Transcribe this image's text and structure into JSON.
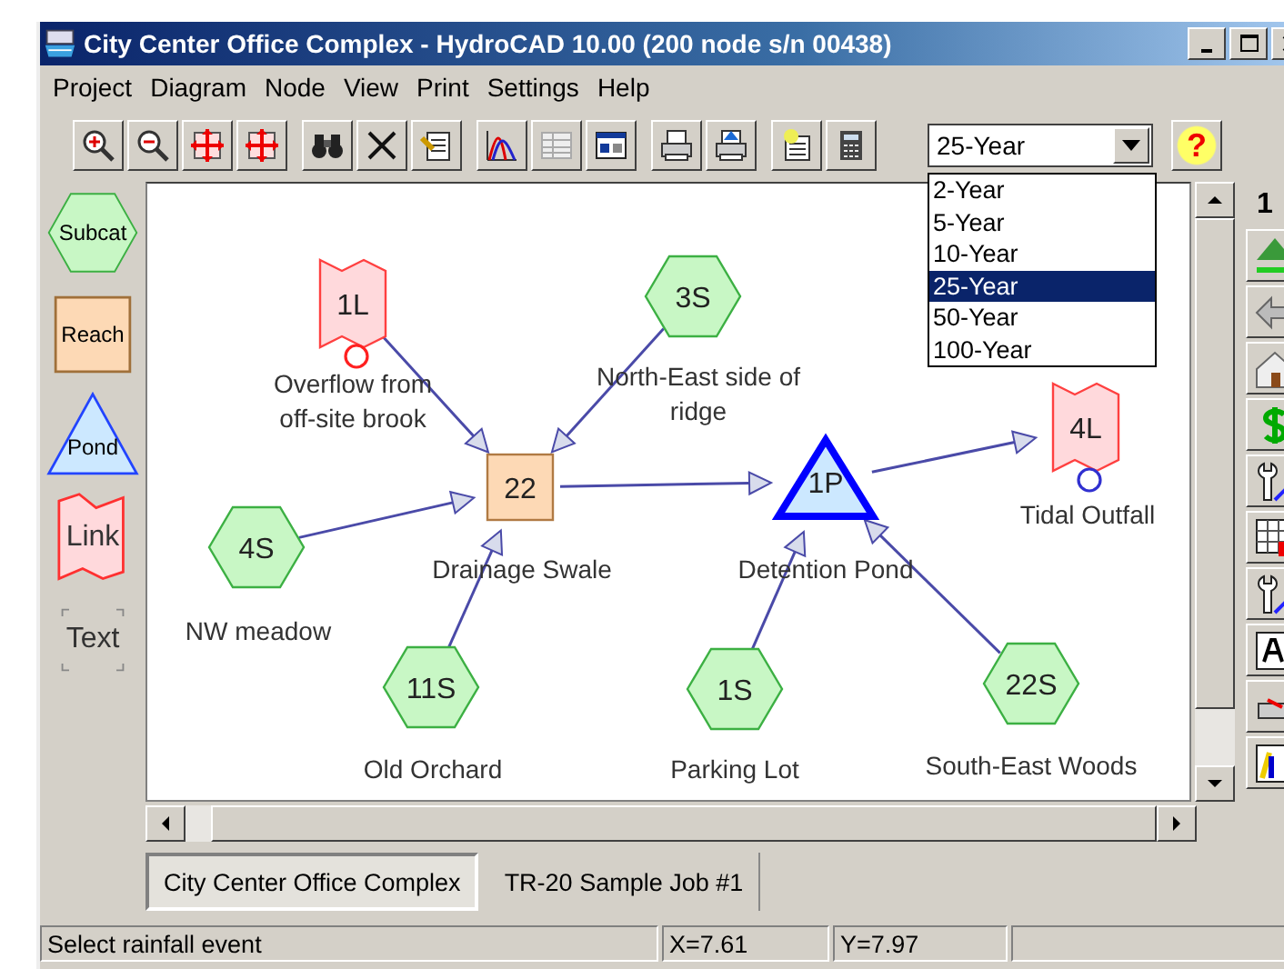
{
  "window": {
    "title": "City Center Office Complex - HydroCAD 10.00 (200 node s/n 00438)"
  },
  "menu": [
    "Project",
    "Diagram",
    "Node",
    "View",
    "Print",
    "Settings",
    "Help"
  ],
  "rainfall": {
    "value": "25-Year",
    "options": [
      {
        "label": "2-Year",
        "selected": false
      },
      {
        "label": "5-Year",
        "selected": false
      },
      {
        "label": "10-Year",
        "selected": false
      },
      {
        "label": "25-Year",
        "selected": true
      },
      {
        "label": "50-Year",
        "selected": false
      },
      {
        "label": "100-Year",
        "selected": false
      }
    ]
  },
  "help_button": {
    "label": "?"
  },
  "palette": [
    {
      "kind": "subcat",
      "label": "Subcat"
    },
    {
      "kind": "reach",
      "label": "Reach"
    },
    {
      "kind": "pond",
      "label": "Pond"
    },
    {
      "kind": "link",
      "label": "Link"
    },
    {
      "kind": "text",
      "label": "Text"
    }
  ],
  "nodes": [
    {
      "kind": "link",
      "id": "1L",
      "label": [
        "Overflow from",
        "off-site brook"
      ],
      "color": "#ff2020",
      "selected": false
    },
    {
      "kind": "subcat",
      "id": "3S",
      "label": [
        "North-East side of",
        "ridge"
      ],
      "selected": false
    },
    {
      "kind": "reach",
      "id": "22",
      "label": [
        "Drainage Swale"
      ],
      "selected": false
    },
    {
      "kind": "subcat",
      "id": "4S",
      "label": [
        "NW meadow"
      ],
      "selected": false
    },
    {
      "kind": "pond",
      "id": "1P",
      "label": [
        "Detention Pond"
      ],
      "selected": true
    },
    {
      "kind": "link",
      "id": "4L",
      "label": [
        "Tidal Outfall"
      ],
      "color": "#3030d0",
      "selected": false
    },
    {
      "kind": "subcat",
      "id": "11S",
      "label": [
        "Old Orchard"
      ],
      "selected": false
    },
    {
      "kind": "subcat",
      "id": "1S",
      "label": [
        "Parking Lot"
      ],
      "selected": false
    },
    {
      "kind": "subcat",
      "id": "22S",
      "label": [
        "South-East Woods"
      ],
      "selected": false
    }
  ],
  "right_toolbar": {
    "top_label": "1"
  },
  "tabs": [
    {
      "label": "City Center Office Complex",
      "selected": true
    },
    {
      "label": "TR-20 Sample Job #1",
      "selected": false
    }
  ],
  "status_bar": {
    "message": "Select rainfall event",
    "x": "X=7.61",
    "y": "Y=7.97"
  }
}
